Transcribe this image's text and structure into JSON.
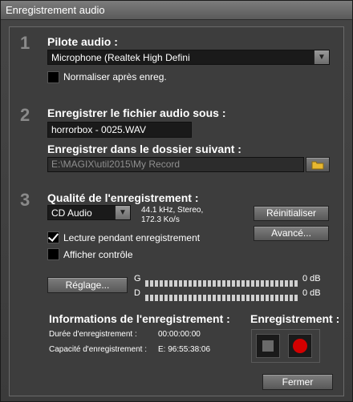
{
  "window": {
    "title": "Enregistrement audio"
  },
  "section1": {
    "number": "1",
    "heading": "Pilote audio :",
    "driver_value": "Microphone (Realtek High Defini",
    "normalize_label": "Normaliser après enreg.",
    "normalize_checked": false
  },
  "section2": {
    "number": "2",
    "file_heading": "Enregistrer le fichier audio sous :",
    "file_value": "horrorbox - 0025.WAV",
    "folder_heading": "Enregistrer dans le dossier suivant :",
    "folder_value": "E:\\MAGIX\\util2015\\My Record"
  },
  "section3": {
    "number": "3",
    "heading": "Qualité de l'enregistrement :",
    "quality_value": "CD Audio",
    "format_line1": "44.1 kHz, Stereo,",
    "format_line2": "172.3 Ko/s",
    "reset_label": "Réinitialiser",
    "advanced_label": "Avancé...",
    "monitor_label": "Lecture pendant enregistrement",
    "monitor_checked": true,
    "control_label": "Afficher contrôle",
    "control_checked": false
  },
  "meters": {
    "settings_label": "Réglage...",
    "left_channel": "G",
    "right_channel": "D",
    "left_db": "0 dB",
    "right_db": "0 dB"
  },
  "info": {
    "heading": "Informations de l'enregistrement :",
    "duration_label": "Durée d'enregistrement :",
    "duration_value": "00:00:00:00",
    "capacity_label": "Capacité d'enregistrement :",
    "capacity_value": "E: 96:55:38:06"
  },
  "recording": {
    "heading": "Enregistrement :",
    "stop_icon": "stop-icon",
    "record_icon": "record-icon",
    "record_color": "#d40000"
  },
  "footer": {
    "close_label": "Fermer"
  },
  "icons": {
    "folder": "folder-icon",
    "dropdown": "chevron-down-icon"
  }
}
